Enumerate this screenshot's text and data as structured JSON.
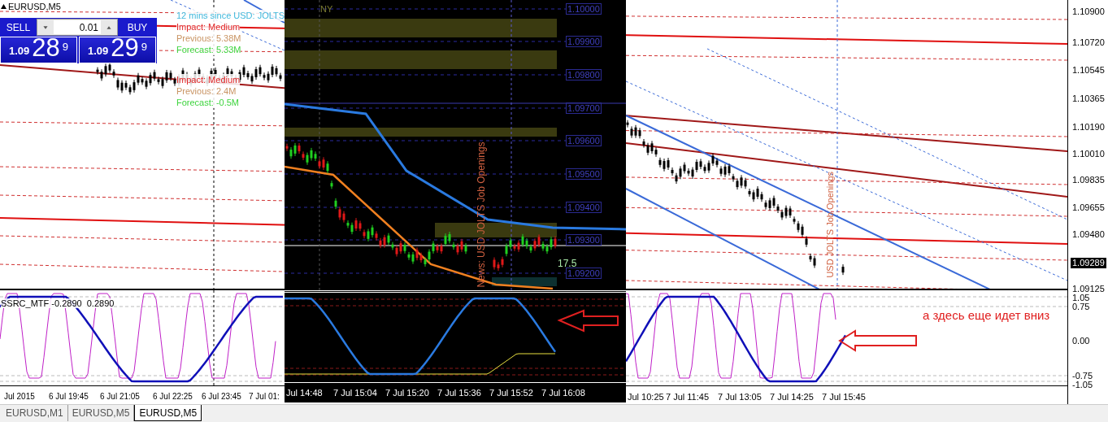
{
  "chart": {
    "symbol": "EURUSD,M5",
    "trade_panel": {
      "sell": "SELL",
      "buy": "BUY",
      "lot": "0.01",
      "bid": {
        "big": "1.09",
        "pips": "28",
        "point": "9"
      },
      "ask": {
        "big": "1.09",
        "pips": "29",
        "point": "9"
      }
    },
    "news": [
      {
        "lines": [
          {
            "kind": "title",
            "text": "12 mins since USD: JOLTS"
          },
          {
            "kind": "impact",
            "text": "Impact: Medium"
          },
          {
            "kind": "previous",
            "text": "Previous: 5.38M"
          },
          {
            "kind": "forecast",
            "text": "Forecast: 5.33M"
          }
        ]
      },
      {
        "lines": [
          {
            "kind": "impact",
            "text": "Impact: Medium"
          },
          {
            "kind": "previous",
            "text": "Previous: 2.4M"
          },
          {
            "kind": "forecast",
            "text": "Forecast: -0.5M"
          }
        ]
      }
    ],
    "event_label": "USD JOLTS Job Openings",
    "price_axis": [
      {
        "text": "1.10900",
        "current": false
      },
      {
        "text": "1.10720",
        "current": false
      },
      {
        "text": "1.10545",
        "current": false
      },
      {
        "text": "1.10365",
        "current": false
      },
      {
        "text": "1.10190",
        "current": false
      },
      {
        "text": "1.10010",
        "current": false
      },
      {
        "text": "1.09835",
        "current": false
      },
      {
        "text": "1.09655",
        "current": false
      },
      {
        "text": "1.09480",
        "current": false
      },
      {
        "text": "1.09289",
        "current": true
      },
      {
        "text": "1.09125",
        "current": false
      }
    ]
  },
  "indicator": {
    "title": "SSRC_MTF -0.2890  0.2890",
    "axis": [
      "1.05",
      "0.75",
      "0.00",
      "-0.75",
      "-1.05"
    ],
    "note": "а здесь еще идет вниз"
  },
  "time_axis": {
    "left": [
      "Jul 2015",
      "6 Jul 19:45",
      "6 Jul 21:05",
      "6 Jul 22:25",
      "6 Jul 23:45",
      "7 Jul 01:"
    ],
    "right": [
      "Jul 10:25",
      "7 Jul 11:45",
      "7 Jul 13:05",
      "7 Jul 14:25",
      "7 Jul 15:45"
    ]
  },
  "inset": {
    "session": "NY",
    "price_levels": [
      "1.10000",
      "1.09900",
      "1.09800",
      "1.09700",
      "1.09600",
      "1.09500",
      "1.09400",
      "1.09300",
      "1.09200"
    ],
    "value": "17.5",
    "event_label": "News: USD JOLTS Job Openings",
    "time_axis": [
      "Jul 14:48",
      "7 Jul 15:04",
      "7 Jul 15:20",
      "7 Jul 15:36",
      "7 Jul 15:52",
      "7 Jul 16:08"
    ]
  },
  "tabs": [
    {
      "label": "EURUSD,M1",
      "selected": false
    },
    {
      "label": "EURUSD,M5",
      "selected": false
    },
    {
      "label": "EURUSD,M5",
      "selected": true
    }
  ]
}
